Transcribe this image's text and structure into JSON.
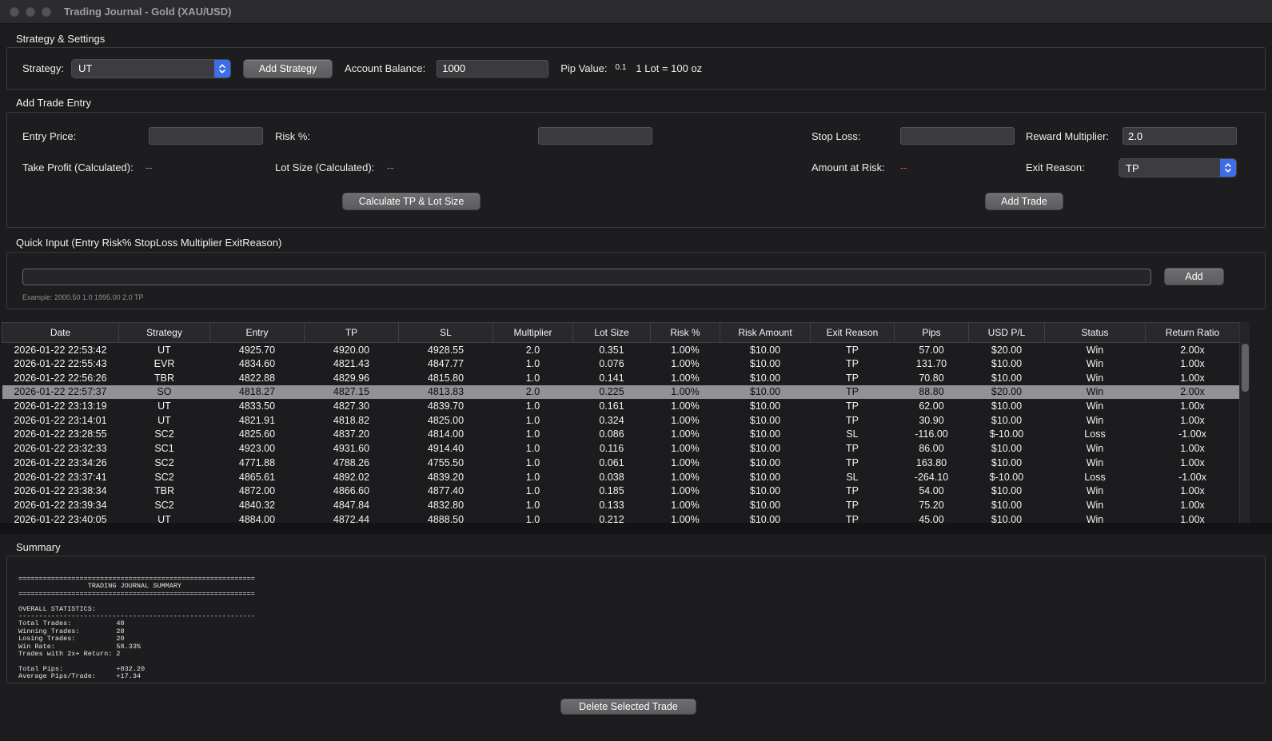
{
  "window": {
    "title": "Trading Journal - Gold (XAU/USD)"
  },
  "strategy_settings": {
    "section_title": "Strategy & Settings",
    "strategy_label": "Strategy:",
    "strategy_value": "UT",
    "add_strategy_button": "Add Strategy",
    "account_balance_label": "Account Balance:",
    "account_balance_value": "1000",
    "pip_value_label": "Pip Value:",
    "pip_value": "0.1",
    "lot_info": "1 Lot = 100 oz"
  },
  "add_trade": {
    "section_title": "Add Trade Entry",
    "entry_price_label": "Entry Price:",
    "entry_price_value": "",
    "risk_label": "Risk %:",
    "risk_value": "",
    "stop_loss_label": "Stop Loss:",
    "stop_loss_value": "",
    "reward_multiplier_label": "Reward Multiplier:",
    "reward_multiplier_value": "2.0",
    "take_profit_label": "Take Profit (Calculated):",
    "take_profit_value": "--",
    "lot_size_label": "Lot Size (Calculated):",
    "lot_size_value": "--",
    "amount_at_risk_label": "Amount at Risk:",
    "amount_at_risk_value": "--",
    "exit_reason_label": "Exit Reason:",
    "exit_reason_value": "TP",
    "calculate_button": "Calculate TP & Lot Size",
    "add_trade_button": "Add Trade"
  },
  "quick_input": {
    "section_title": "Quick Input (Entry Risk% StopLoss Multiplier ExitReason)",
    "input_value": "",
    "add_button": "Add",
    "example": "Example: 2000.50 1.0 1995.00 2.0 TP"
  },
  "trades_table": {
    "columns": [
      "Date",
      "Strategy",
      "Entry",
      "TP",
      "SL",
      "Multiplier",
      "Lot Size",
      "Risk %",
      "Risk Amount",
      "Exit Reason",
      "Pips",
      "USD P/L",
      "Status",
      "Return Ratio"
    ],
    "selected_row_index": 3,
    "rows": [
      [
        "2026-01-22 22:53:42",
        "UT",
        "4925.70",
        "4920.00",
        "4928.55",
        "2.0",
        "0.351",
        "1.00%",
        "$10.00",
        "TP",
        "57.00",
        "$20.00",
        "Win",
        "2.00x"
      ],
      [
        "2026-01-22 22:55:43",
        "EVR",
        "4834.60",
        "4821.43",
        "4847.77",
        "1.0",
        "0.076",
        "1.00%",
        "$10.00",
        "TP",
        "131.70",
        "$10.00",
        "Win",
        "1.00x"
      ],
      [
        "2026-01-22 22:56:26",
        "TBR",
        "4822.88",
        "4829.96",
        "4815.80",
        "1.0",
        "0.141",
        "1.00%",
        "$10.00",
        "TP",
        "70.80",
        "$10.00",
        "Win",
        "1.00x"
      ],
      [
        "2026-01-22 22:57:37",
        "SO",
        "4818.27",
        "4827.15",
        "4813.83",
        "2.0",
        "0.225",
        "1.00%",
        "$10.00",
        "TP",
        "88.80",
        "$20.00",
        "Win",
        "2.00x"
      ],
      [
        "2026-01-22 23:13:19",
        "UT",
        "4833.50",
        "4827.30",
        "4839.70",
        "1.0",
        "0.161",
        "1.00%",
        "$10.00",
        "TP",
        "62.00",
        "$10.00",
        "Win",
        "1.00x"
      ],
      [
        "2026-01-22 23:14:01",
        "UT",
        "4821.91",
        "4818.82",
        "4825.00",
        "1.0",
        "0.324",
        "1.00%",
        "$10.00",
        "TP",
        "30.90",
        "$10.00",
        "Win",
        "1.00x"
      ],
      [
        "2026-01-22 23:28:55",
        "SC2",
        "4825.60",
        "4837.20",
        "4814.00",
        "1.0",
        "0.086",
        "1.00%",
        "$10.00",
        "SL",
        "-116.00",
        "$-10.00",
        "Loss",
        "-1.00x"
      ],
      [
        "2026-01-22 23:32:33",
        "SC1",
        "4923.00",
        "4931.60",
        "4914.40",
        "1.0",
        "0.116",
        "1.00%",
        "$10.00",
        "TP",
        "86.00",
        "$10.00",
        "Win",
        "1.00x"
      ],
      [
        "2026-01-22 23:34:26",
        "SC2",
        "4771.88",
        "4788.26",
        "4755.50",
        "1.0",
        "0.061",
        "1.00%",
        "$10.00",
        "TP",
        "163.80",
        "$10.00",
        "Win",
        "1.00x"
      ],
      [
        "2026-01-22 23:37:41",
        "SC2",
        "4865.61",
        "4892.02",
        "4839.20",
        "1.0",
        "0.038",
        "1.00%",
        "$10.00",
        "SL",
        "-264.10",
        "$-10.00",
        "Loss",
        "-1.00x"
      ],
      [
        "2026-01-22 23:38:34",
        "TBR",
        "4872.00",
        "4866.60",
        "4877.40",
        "1.0",
        "0.185",
        "1.00%",
        "$10.00",
        "TP",
        "54.00",
        "$10.00",
        "Win",
        "1.00x"
      ],
      [
        "2026-01-22 23:39:34",
        "SC2",
        "4840.32",
        "4847.84",
        "4832.80",
        "1.0",
        "0.133",
        "1.00%",
        "$10.00",
        "TP",
        "75.20",
        "$10.00",
        "Win",
        "1.00x"
      ],
      [
        "2026-01-22 23:40:05",
        "UT",
        "4884.00",
        "4872.44",
        "4888.50",
        "1.0",
        "0.212",
        "1.00%",
        "$10.00",
        "TP",
        "45.00",
        "$10.00",
        "Win",
        "1.00x"
      ]
    ]
  },
  "summary": {
    "section_title": "Summary",
    "text": "==========================================================\n                 TRADING JOURNAL SUMMARY\n==========================================================\n\nOVERALL STATISTICS:\n----------------------------------------------------------\nTotal Trades:           48\nWinning Trades:         28\nLosing Trades:          20\nWin Rate:               58.33%\nTrades with 2x+ Return: 2\n\nTotal Pips:             +832.20\nAverage Pips/Trade:     +17.34"
  },
  "footer": {
    "delete_button": "Delete Selected Trade"
  }
}
